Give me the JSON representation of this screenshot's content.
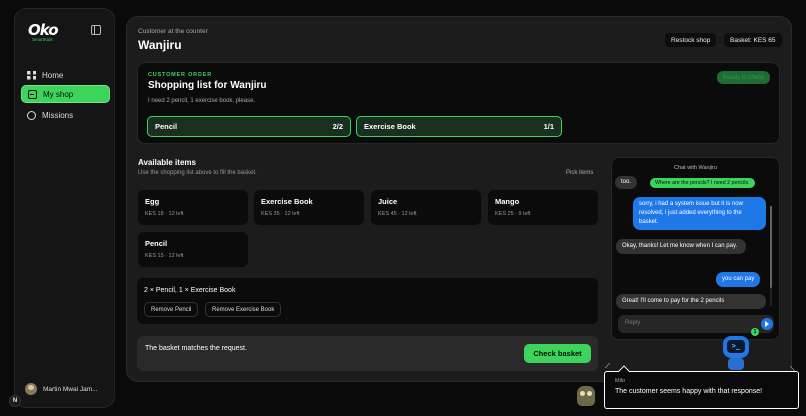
{
  "sidebar": {
    "logo_main": "Oko",
    "logo_sub": "SmartKids",
    "items": [
      {
        "label": "Home",
        "icon": "grid-icon"
      },
      {
        "label": "My shop",
        "icon": "shop-icon",
        "active": true
      },
      {
        "label": "Missions",
        "icon": "target-icon"
      }
    ],
    "user_name": "Martin Mwai Jam..."
  },
  "header": {
    "subtitle": "Customer at the counter",
    "title": "Wanjiru",
    "restock_label": "Restock shop",
    "basket_label": "Basket: KES 65"
  },
  "order": {
    "kicker": "CUSTOMER ORDER",
    "title": "Shopping list for Wanjiru",
    "description": "I need 2 pencil, 1 exercise book, please.",
    "ready_label": "Ready to check",
    "items": [
      {
        "name": "Pencil",
        "count": "2/2"
      },
      {
        "name": "Exercise Book",
        "count": "1/1"
      }
    ]
  },
  "available": {
    "title": "Available items",
    "subtitle": "Use the shopping list above to fill the basket.",
    "pick_label": "Pick items",
    "products": [
      {
        "name": "Egg",
        "meta": "KES 18 · 12 left"
      },
      {
        "name": "Exercise Book",
        "meta": "KES 35 · 12 left"
      },
      {
        "name": "Juice",
        "meta": "KES 45 · 12 left"
      },
      {
        "name": "Mango",
        "meta": "KES 25 · 9 left"
      },
      {
        "name": "Pencil",
        "meta": "KES 15 · 12 left"
      }
    ]
  },
  "basket": {
    "summary": "2 × Pencil, 1 × Exercise Book",
    "remove_pencil": "Remove Pencil",
    "remove_book": "Remove Exercise Book"
  },
  "status": {
    "text": "The basket matches the request.",
    "check_label": "Check basket"
  },
  "chat": {
    "title": "Chat with Wanjiru",
    "note": "Where are the pencils? I need 2 pencils.",
    "messages": [
      {
        "from": "customer",
        "text": "too."
      },
      {
        "from": "me",
        "text": "sorry, i had a system issue but it is now resolved, i just added everything to the basket."
      },
      {
        "from": "customer",
        "text": "Okay, thanks! Let me know when I can pay."
      },
      {
        "from": "me",
        "text": "you can pay"
      },
      {
        "from": "customer",
        "text": "Great! I'll come to pay for the 2 pencils"
      }
    ],
    "reply_placeholder": "Reply",
    "unread": "1"
  },
  "mascot": {
    "face": ">_",
    "name": "Milo",
    "text": "The customer seems happy with that response!"
  },
  "corner_badge": "N",
  "colors": {
    "accent": "#3dd45c",
    "chat_blue": "#1f78e8"
  }
}
